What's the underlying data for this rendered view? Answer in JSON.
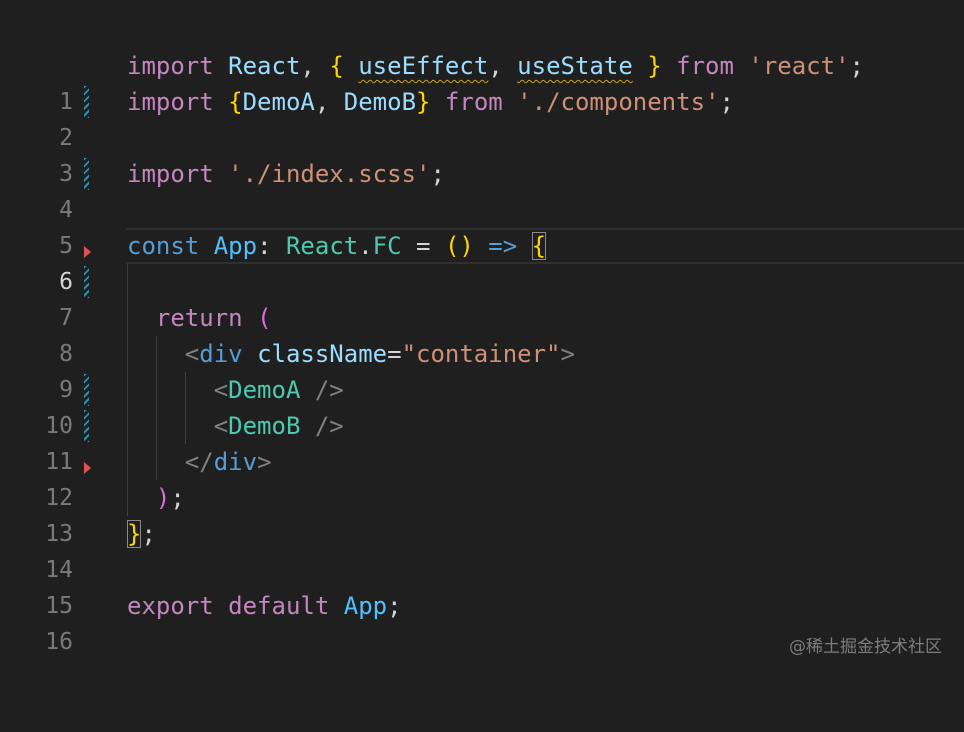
{
  "gutter": {
    "line_numbers": [
      "1",
      "2",
      "3",
      "4",
      "5",
      "6",
      "7",
      "8",
      "9",
      "10",
      "11",
      "12",
      "13",
      "14",
      "15",
      "16"
    ],
    "current_line": "6"
  },
  "code": {
    "l1": {
      "import": "import",
      "react": "React",
      "comma": ",",
      "ob": "{",
      "useEffect": "useEffect",
      "comma2": ",",
      "useState": "useState",
      "cb": "}",
      "from": "from",
      "src": "'react'",
      "semi": ";"
    },
    "l2": {
      "import": "import",
      "ob": "{",
      "demoA": "DemoA",
      "comma": ",",
      "demoB": "DemoB",
      "cb": "}",
      "from": "from",
      "src": "'./components'",
      "semi": ";"
    },
    "l4": {
      "import": "import",
      "src": "'./index.scss'",
      "semi": ";"
    },
    "l6": {
      "const": "const",
      "app": "App",
      "colon": ":",
      "react": "React",
      "dot": ".",
      "fc": "FC",
      "eq": "=",
      "parens": "()",
      "arrow": "=>",
      "ob": "{"
    },
    "l8": {
      "return": "return",
      "op": "("
    },
    "l9": {
      "lt": "<",
      "div": "div",
      "attr": "className",
      "eq": "=",
      "val": "\"container\"",
      "gt": ">"
    },
    "l10": {
      "lt": "<",
      "comp": "DemoA",
      "close": " />"
    },
    "l11": {
      "lt": "<",
      "comp": "DemoB",
      "close": " />"
    },
    "l12": {
      "lt": "</",
      "div": "div",
      "gt": ">"
    },
    "l13": {
      "cp": ")",
      "semi": ";"
    },
    "l14": {
      "cb": "}",
      "semi": ";"
    },
    "l16": {
      "export": "export",
      "default": "default",
      "app": "App",
      "semi": ";"
    }
  },
  "watermark": "@稀土掘金技术社区",
  "colors": {
    "background": "#1f1f1f",
    "keyword": "#c586c0",
    "storage": "#569cd6",
    "identifier": "#9cdcfe",
    "type": "#4ec9b0",
    "string": "#ce9178",
    "bracket": "#ffd700",
    "modified_marker": "#2a8fb0",
    "deleted_marker": "#e05252"
  }
}
